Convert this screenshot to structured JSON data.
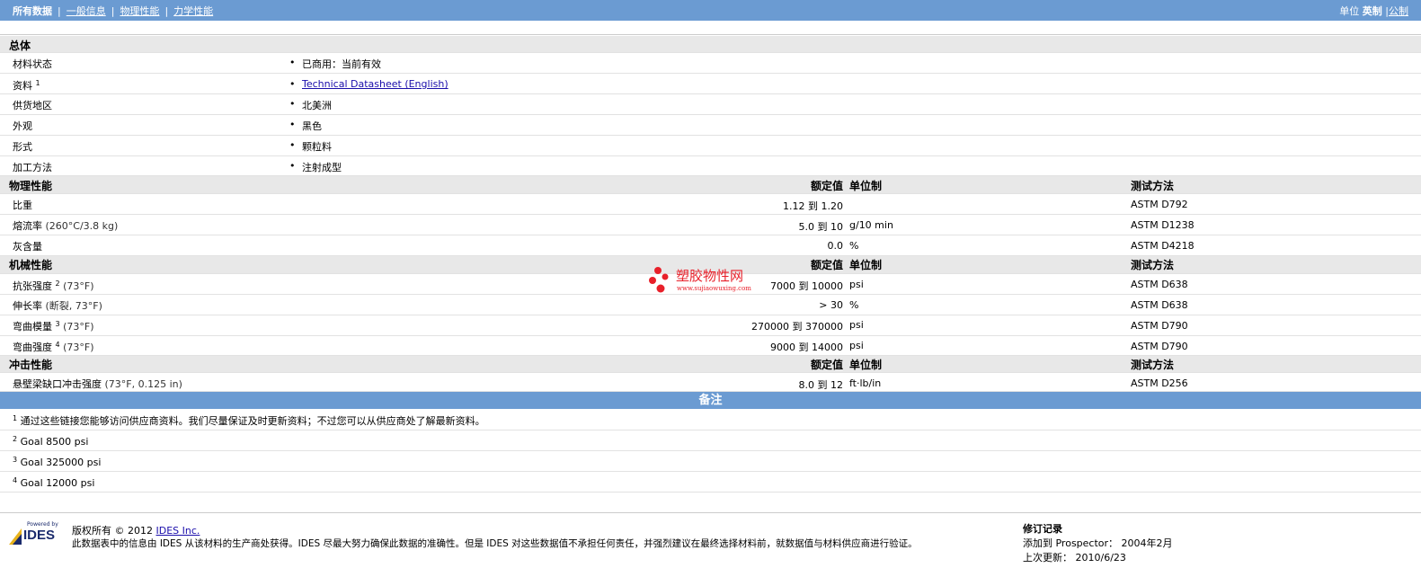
{
  "nav": {
    "active": "所有数据",
    "links": [
      "一般信息",
      "物理性能",
      "力学性能"
    ],
    "separator": "|"
  },
  "units": {
    "label": "单位",
    "selected": "英制",
    "separator": "|",
    "other": "公制"
  },
  "general": {
    "title": "总体",
    "rows": [
      {
        "label": "材料状态",
        "sup": "",
        "value": "已商用：当前有效"
      },
      {
        "label": "资料",
        "sup": "1",
        "value": "Technical Datasheet (English)"
      },
      {
        "label": "供货地区",
        "sup": "",
        "value": "北美洲"
      },
      {
        "label": "外观",
        "sup": "",
        "value": "黑色"
      },
      {
        "label": "形式",
        "sup": "",
        "value": "颗粒料"
      },
      {
        "label": "加工方法",
        "sup": "",
        "value": "注射成型"
      }
    ],
    "bullet": "•"
  },
  "headers": {
    "rated": "额定值",
    "unit": "单位制",
    "test": "测试方法"
  },
  "physical": {
    "title": "物理性能",
    "rows": [
      {
        "label": "比重",
        "sup": "",
        "cond": "",
        "rated": "1.12 到  1.20",
        "unit": "",
        "test": "ASTM D792"
      },
      {
        "label": "熔流率",
        "sup": "",
        "cond": "(260°C/3.8 kg)",
        "rated": "5.0 到  10",
        "unit": "g/10 min",
        "test": "ASTM D1238"
      },
      {
        "label": "灰含量",
        "sup": "",
        "cond": "",
        "rated": "0.0",
        "unit": "%",
        "test": "ASTM D4218"
      }
    ]
  },
  "mechanical": {
    "title": "机械性能",
    "rows": [
      {
        "label": "抗张强度",
        "sup": "2",
        "cond": "(73°F)",
        "rated": "7000 到  10000",
        "unit": "psi",
        "test": "ASTM D638"
      },
      {
        "label": "伸长率",
        "sup": "",
        "cond": "(断裂, 73°F)",
        "rated": "> 30",
        "unit": "%",
        "test": "ASTM D638"
      },
      {
        "label": "弯曲模量",
        "sup": "3",
        "cond": "(73°F)",
        "rated": "270000 到  370000",
        "unit": "psi",
        "test": "ASTM D790"
      },
      {
        "label": "弯曲强度",
        "sup": "4",
        "cond": "(73°F)",
        "rated": "9000 到  14000",
        "unit": "psi",
        "test": "ASTM D790"
      }
    ]
  },
  "impact": {
    "title": "冲击性能",
    "rows": [
      {
        "label": "悬壁梁缺口冲击强度",
        "sup": "",
        "cond": "(73°F, 0.125 in)",
        "rated": "8.0 到  12",
        "unit": "ft·lb/in",
        "test": "ASTM D256"
      }
    ]
  },
  "notes": {
    "title": "备注",
    "items": [
      {
        "num": "1",
        "text": "通过这些链接您能够访问供应商资料。我们尽量保证及时更新资料；不过您可以从供应商处了解最新资料。"
      },
      {
        "num": "2",
        "text": "Goal 8500 psi"
      },
      {
        "num": "3",
        "text": "Goal 325000 psi"
      },
      {
        "num": "4",
        "text": "Goal 12000 psi"
      }
    ]
  },
  "footer": {
    "logo_small": "Powered by",
    "logo_word": "IDES",
    "copyright": "版权所有 © 2012",
    "company": "IDES Inc.",
    "disclaimer": "此数据表中的信息由  IDES 从该材料的生产商处获得。IDES 尽最大努力确保此数据的准确性。但是  IDES 对这些数据值不承担任何责任，并强烈建议在最终选择材料前，就数据值与材料供应商进行验证。",
    "revision_title": "修订记录",
    "added_label": "添加到 Prospector：",
    "added_value": "2004年2月",
    "updated_label": "上次更新：",
    "updated_value": "2010/6/23"
  },
  "watermark": {
    "cn": "塑胶物性网",
    "url": "www.sujiaowuxing.com",
    "color": "#e8202a"
  },
  "colors": {
    "bar": "#6b9bd2",
    "section": "#e8e8e8",
    "link": "#1a0dab"
  }
}
